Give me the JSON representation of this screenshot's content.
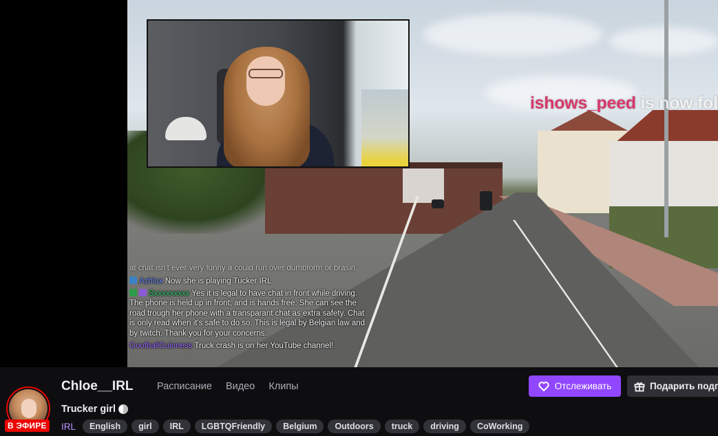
{
  "stream": {
    "alert_name": "ishows_peed",
    "alert_text": " is now follo",
    "chat": {
      "cut_line": "at chat isn't ever very funny a could run over dumbform or brasin",
      "messages": [
        {
          "user": "Azhlux",
          "text": " Now she is playing Tucker IRL"
        },
        {
          "user": "Sxxxxxxxxx",
          "text": " Yes it is legal to have chat in front while driving. The phone is held up in front, and is hands free. She can see the road trough her phone with a transparant chat as extra safety. Chat is only read when it's safe to do so. This is legal by Belgian law and by twitch. Thank you for your concerns."
        },
        {
          "user": "GoofballGuinness",
          "text": " Truck crash is on her YouTube channel!"
        }
      ]
    }
  },
  "channel": {
    "name": "Chloe__IRL",
    "live_label": "В ЭФИРЕ",
    "title": "Trucker girl",
    "category": "IRL",
    "tags": [
      "English",
      "girl",
      "IRL",
      "LGBTQFriendly",
      "Belgium",
      "Outdoors",
      "truck",
      "driving",
      "CoWorking"
    ]
  },
  "nav": {
    "schedule": "Расписание",
    "videos": "Видео",
    "clips": "Клипы"
  },
  "actions": {
    "follow_label": "Отслеживать",
    "gift_label": "Подарить подписку"
  },
  "colors": {
    "accent": "#9147ff",
    "live": "#eb0400",
    "category": "#bf94ff"
  }
}
